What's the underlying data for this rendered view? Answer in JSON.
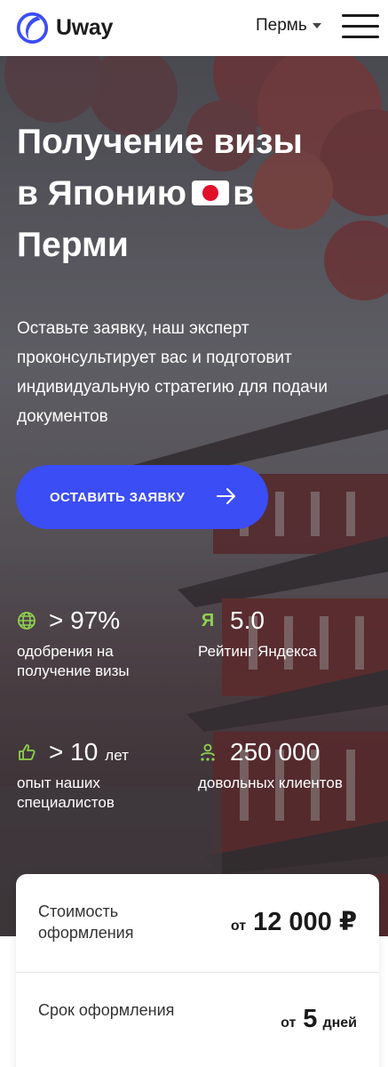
{
  "header": {
    "brand": "Uway",
    "city": "Пермь"
  },
  "hero": {
    "title_line1": "Получение визы",
    "title_line2a": "в Японию",
    "title_line2b": "в",
    "title_line3": "Перми",
    "subtitle": "Оставьте заявку, наш эксперт проконсультирует вас и подготовит индивидуальную стратегию для подачи документов",
    "cta_label": "ОСТАВИТЬ ЗАЯВКУ"
  },
  "stats": [
    {
      "icon": "globe-icon",
      "value": "> 97%",
      "unit": "",
      "desc": "одобрения на получение визы"
    },
    {
      "icon": "yandex-icon",
      "icon_glyph": "Я",
      "value": "5.0",
      "unit": "",
      "desc": "Рейтинг Яндекса"
    },
    {
      "icon": "thumbs-up-icon",
      "value": "> 10",
      "unit": "лет",
      "desc": "опыт наших специалистов"
    },
    {
      "icon": "clients-icon",
      "value": "250 000",
      "unit": "",
      "desc": "довольных клиентов"
    }
  ],
  "pricing": {
    "cost_label": "Стоимость оформления",
    "cost_prefix": "от",
    "cost_value": "12 000 ₽",
    "term_label": "Срок оформления",
    "term_prefix": "от",
    "term_value": "5",
    "term_unit": "дней"
  },
  "colors": {
    "accent": "#3b4df5",
    "icon_green": "#8fd14f",
    "logo_blue": "#3b4df5",
    "flag_red": "#e0102a"
  }
}
